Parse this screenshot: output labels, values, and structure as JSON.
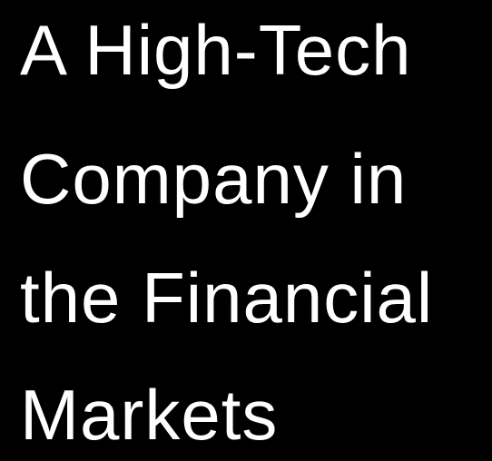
{
  "title": {
    "lines": [
      "A High-Tech",
      "Company in",
      "the Financial",
      "Markets"
    ]
  },
  "colors": {
    "background": "#000000",
    "text": "#ffffff"
  }
}
